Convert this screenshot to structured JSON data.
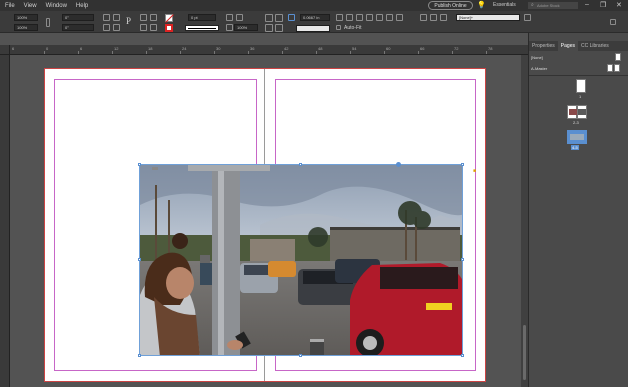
{
  "menubar": {
    "items": [
      "File",
      "View",
      "Window",
      "Help"
    ],
    "publish_label": "Publish Online",
    "essentials_label": "Essentials",
    "search_placeholder": "Adobe Stock",
    "bulb_glyph": "💡",
    "minimize_glyph": "–",
    "maximize_glyph": "❐",
    "close_glyph": "✕"
  },
  "control": {
    "x_value": "100%",
    "y_value": "100%",
    "angle_value": "0°",
    "shear_value": "0°",
    "stroke_value": "0 pt",
    "opacity_value": "100%",
    "spacing_value": "0.0667 in",
    "auto_fit_label": "Auto-Fit",
    "style_value": "[None]+",
    "type_glyph": "P"
  },
  "ruler": {
    "labels": [
      "6",
      "0",
      "6",
      "12",
      "18",
      "24",
      "30",
      "36",
      "42",
      "48",
      "54",
      "60",
      "66",
      "72",
      "78"
    ]
  },
  "panel": {
    "tabs": [
      "Properties",
      "Pages",
      "CC Libraries"
    ],
    "none_label": "[None]",
    "master_label": "A-Master",
    "page1_label": "1",
    "spread_label": "2-3",
    "page4_label": "4-5"
  },
  "colors": {
    "selection": "#5a8fd0",
    "margin_guide": "#c766c7",
    "bleed": "#cc4444",
    "red_car": "#b01a2a",
    "sky": "#a9b6c8"
  }
}
